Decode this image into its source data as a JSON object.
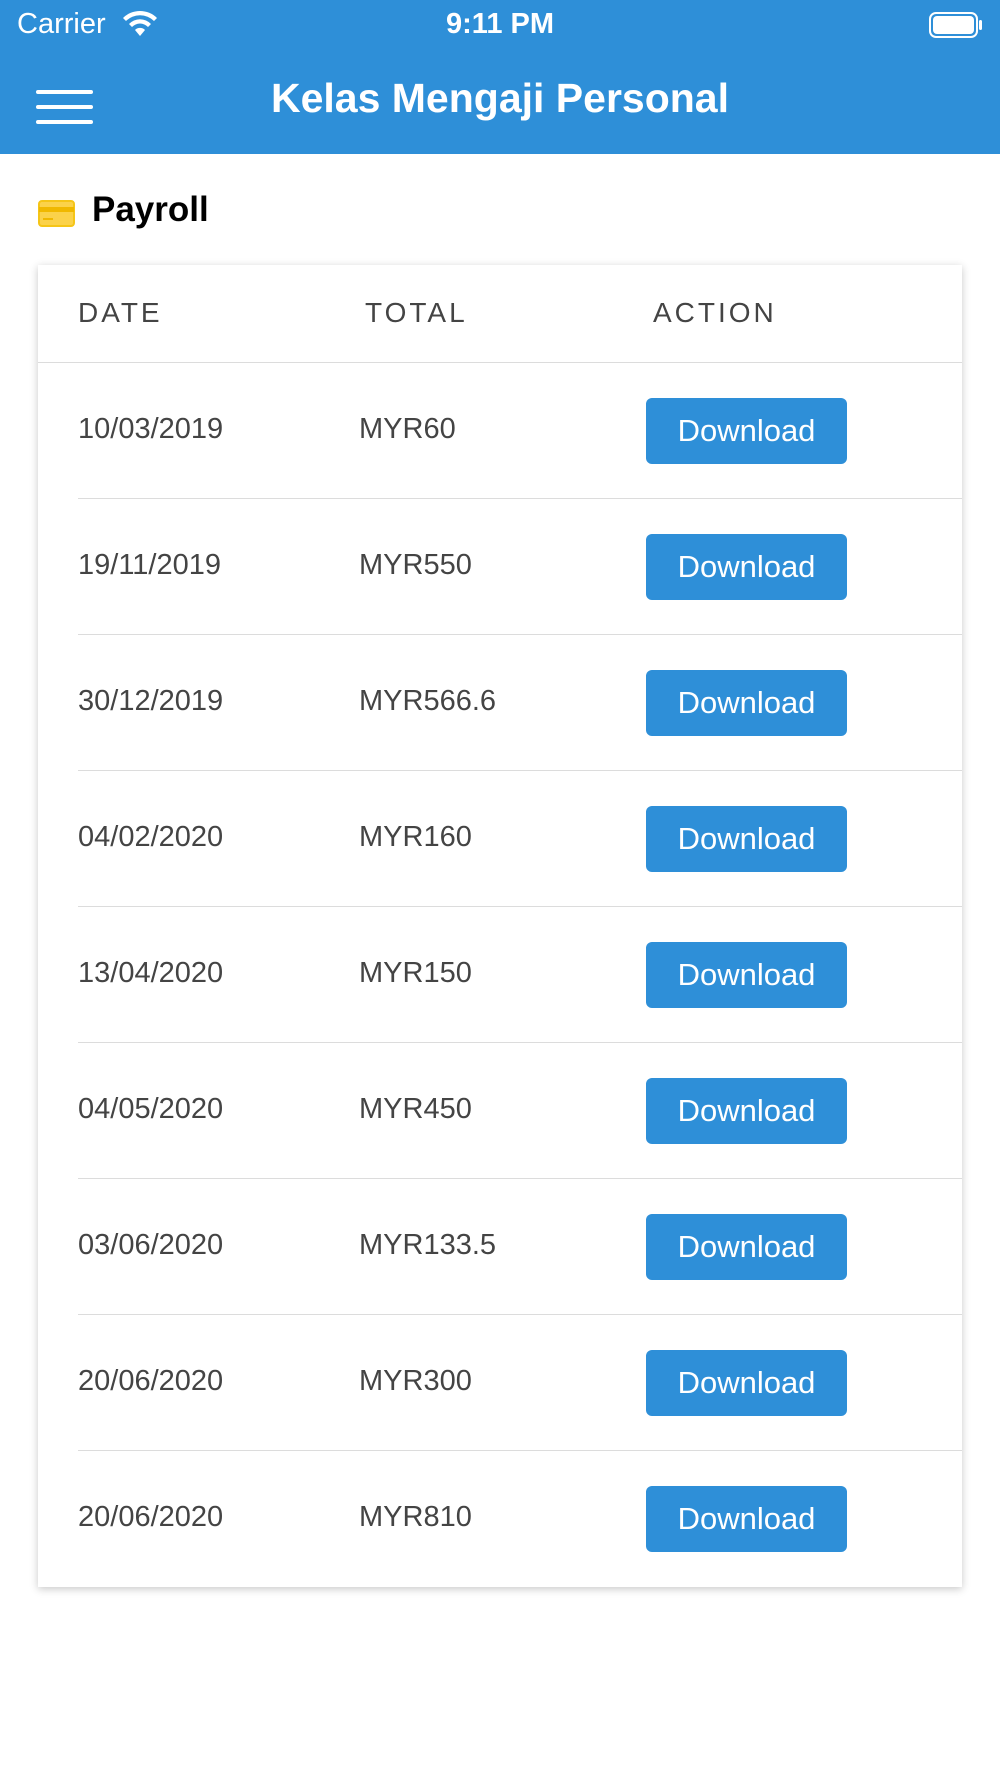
{
  "status_bar": {
    "carrier": "Carrier",
    "time": "9:11 PM",
    "icons": [
      "wifi-icon",
      "battery-icon"
    ]
  },
  "header": {
    "title": "Kelas Mengaji Personal",
    "menu_icon": "hamburger-menu-icon",
    "background_color": "#2e8fd8"
  },
  "section": {
    "title": "Payroll",
    "icon": "credit-card-icon",
    "icon_color": "#f5c518"
  },
  "table": {
    "columns": [
      "DATE",
      "TOTAL",
      "ACTION"
    ],
    "rows": [
      {
        "date": "10/03/2019",
        "total": "MYR60",
        "action": "Download"
      },
      {
        "date": "19/11/2019",
        "total": "MYR550",
        "action": "Download"
      },
      {
        "date": "30/12/2019",
        "total": "MYR566.6",
        "action": "Download"
      },
      {
        "date": "04/02/2020",
        "total": "MYR160",
        "action": "Download"
      },
      {
        "date": "13/04/2020",
        "total": "MYR150",
        "action": "Download"
      },
      {
        "date": "04/05/2020",
        "total": "MYR450",
        "action": "Download"
      },
      {
        "date": "03/06/2020",
        "total": "MYR133.5",
        "action": "Download"
      },
      {
        "date": "20/06/2020",
        "total": "MYR300",
        "action": "Download"
      },
      {
        "date": "20/06/2020",
        "total": "MYR810",
        "action": "Download"
      }
    ]
  },
  "colors": {
    "accent": "#2e8fd8",
    "text_muted": "#444444",
    "divider": "#dcdcdc"
  }
}
